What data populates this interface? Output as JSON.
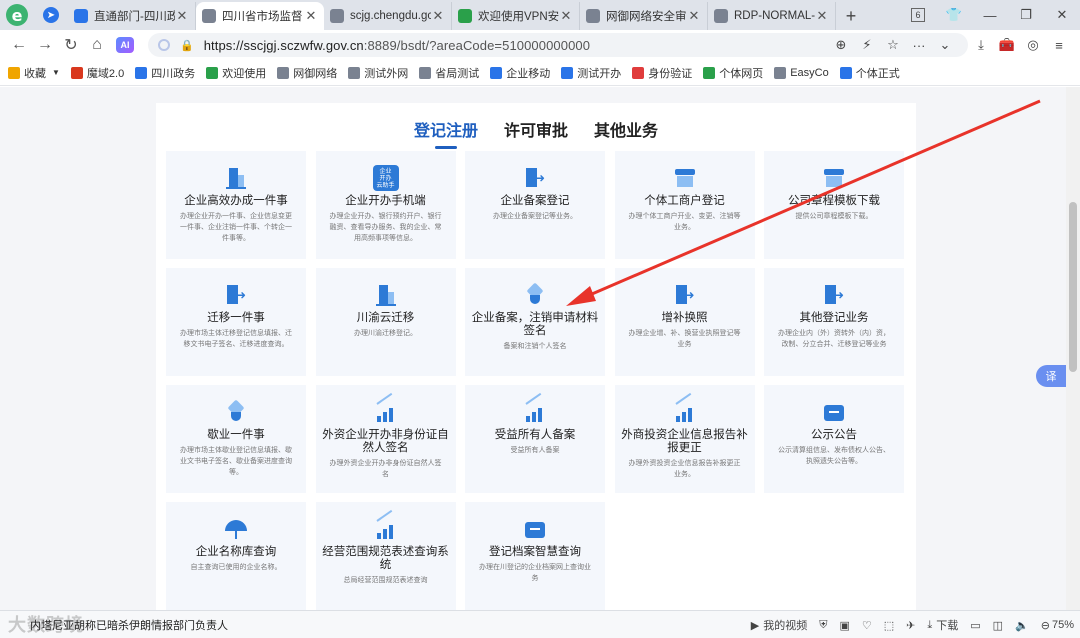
{
  "tabbar": {
    "tabs": [
      {
        "title": "直通部门-四川政",
        "icon": "government-icon",
        "color": "#2a74e8",
        "active": false
      },
      {
        "title": "四川省市场监督",
        "icon": "globe-icon",
        "color": "#7a8291",
        "active": true
      },
      {
        "title": "scjg.chengdu.gc",
        "icon": "globe-icon",
        "color": "#7a8291",
        "active": false
      },
      {
        "title": "欢迎使用VPN安",
        "icon": "shield-icon",
        "color": "#2aa04a",
        "active": false
      },
      {
        "title": "网御网络安全审",
        "icon": "globe-icon",
        "color": "#7a8291",
        "active": false
      },
      {
        "title": "RDP-NORMAL-",
        "icon": "globe-icon",
        "color": "#7a8291",
        "active": false
      }
    ],
    "tab_count": "6"
  },
  "address": {
    "url_main": "https://sscjgj.sczwfw.gov.cn",
    "url_rest": ":8889/bsdt/?areaCode=510000000000"
  },
  "bookmarks": [
    {
      "label": "收藏",
      "icon": "star-icon",
      "color": "#f0a500"
    },
    {
      "label": "魔域2.0",
      "icon": "game-icon",
      "color": "#d9381e"
    },
    {
      "label": "四川政务",
      "icon": "government-icon",
      "color": "#2a74e8"
    },
    {
      "label": "欢迎使用",
      "icon": "shield-icon",
      "color": "#2aa04a"
    },
    {
      "label": "网御网络",
      "icon": "globe-icon",
      "color": "#7a8291"
    },
    {
      "label": "测试外网",
      "icon": "globe-icon",
      "color": "#7a8291"
    },
    {
      "label": "省局测试",
      "icon": "globe-icon",
      "color": "#7a8291"
    },
    {
      "label": "企业移动",
      "icon": "globe-icon",
      "color": "#2a74e8"
    },
    {
      "label": "测试开办",
      "icon": "globe-icon",
      "color": "#2a74e8"
    },
    {
      "label": "身份验证",
      "icon": "id-icon",
      "color": "#e03c3c"
    },
    {
      "label": "个体网页",
      "icon": "grid-icon",
      "color": "#2aa04a"
    },
    {
      "label": "EasyCo",
      "icon": "globe-icon",
      "color": "#7a8291"
    },
    {
      "label": "个体正式",
      "icon": "person-icon",
      "color": "#2a74e8"
    }
  ],
  "page": {
    "tabs": [
      "登记注册",
      "许可审批",
      "其他业务"
    ],
    "cards": [
      {
        "title": "企业高效办成一件事",
        "desc": "办理企业开办一件事、企业信息变更一件事、企业注销一件事、个转企一件事等。",
        "icon": "building-icon"
      },
      {
        "title": "企业开办手机端",
        "desc": "办理企业开办、银行预约开户、银行融资、查看导办服务、我的企业、常用高频事项等信息。",
        "icon": "mobile-app-icon"
      },
      {
        "title": "企业备案登记",
        "desc": "办理企业备案登记等业务。",
        "icon": "transfer-icon"
      },
      {
        "title": "个体工商户登记",
        "desc": "办理个体工商户开业、变更、注销等业务。",
        "icon": "shop-icon"
      },
      {
        "title": "公司章程模板下载",
        "desc": "提供公司章程模板下载。",
        "icon": "shop-icon"
      },
      {
        "title": "迁移一件事",
        "desc": "办理市场主体迁移登记信息填报、迁移文书电子签名、迁移进度查询。",
        "icon": "transfer-icon"
      },
      {
        "title": "川渝云迁移",
        "desc": "办理川渝迁移登记。",
        "icon": "building-icon"
      },
      {
        "title": "企业备案，注销申请材料签名",
        "desc": "备案和注销个人签名",
        "icon": "badge-icon"
      },
      {
        "title": "增补换照",
        "desc": "办理企业增、补、换营业执照登记等业务",
        "icon": "transfer-icon"
      },
      {
        "title": "其他登记业务",
        "desc": "办理企业内（外）资转外（内）资，改制、分立合并、迁移登记等业务",
        "icon": "transfer-icon"
      },
      {
        "title": "歇业一件事",
        "desc": "办理市场主体歇业登记信息填报、歇业文书电子签名、歇业备案进度查询等。",
        "icon": "badge-icon"
      },
      {
        "title": "外资企业开办非身份证自然人签名",
        "desc": "办理外资企业开办非身份证自然人签名",
        "icon": "chart-icon"
      },
      {
        "title": "受益所有人备案",
        "desc": "受益所有人备案",
        "icon": "chart-icon"
      },
      {
        "title": "外商投资企业信息报告补报更正",
        "desc": "办理外资投资企业信息报告补报更正业务。",
        "icon": "chart-icon"
      },
      {
        "title": "公示公告",
        "desc": "公示清算组信息、发布债权人公告、执照遗失公告等。",
        "icon": "briefcase-icon"
      },
      {
        "title": "企业名称库查询",
        "desc": "自主查询已使用的企业名称。",
        "icon": "umbrella-icon"
      },
      {
        "title": "经营范围规范表述查询系统",
        "desc": "总局经营范围规范表述查询",
        "icon": "chart-icon"
      },
      {
        "title": "登记档案智慧查询",
        "desc": "办理在川登记的企业档案网上查询业务",
        "icon": "briefcase-icon"
      }
    ]
  },
  "float_button": "译",
  "statusbar": {
    "news": "内塔尼亚胡称已暗杀伊朗情报部门负责人",
    "watermark": "大数跨境",
    "items": [
      "我的视频",
      "下载",
      "75%"
    ]
  },
  "colors": {
    "accent": "#1f5fbf",
    "arrow": "#e8332a",
    "card_bg": "#f4f7fc"
  }
}
